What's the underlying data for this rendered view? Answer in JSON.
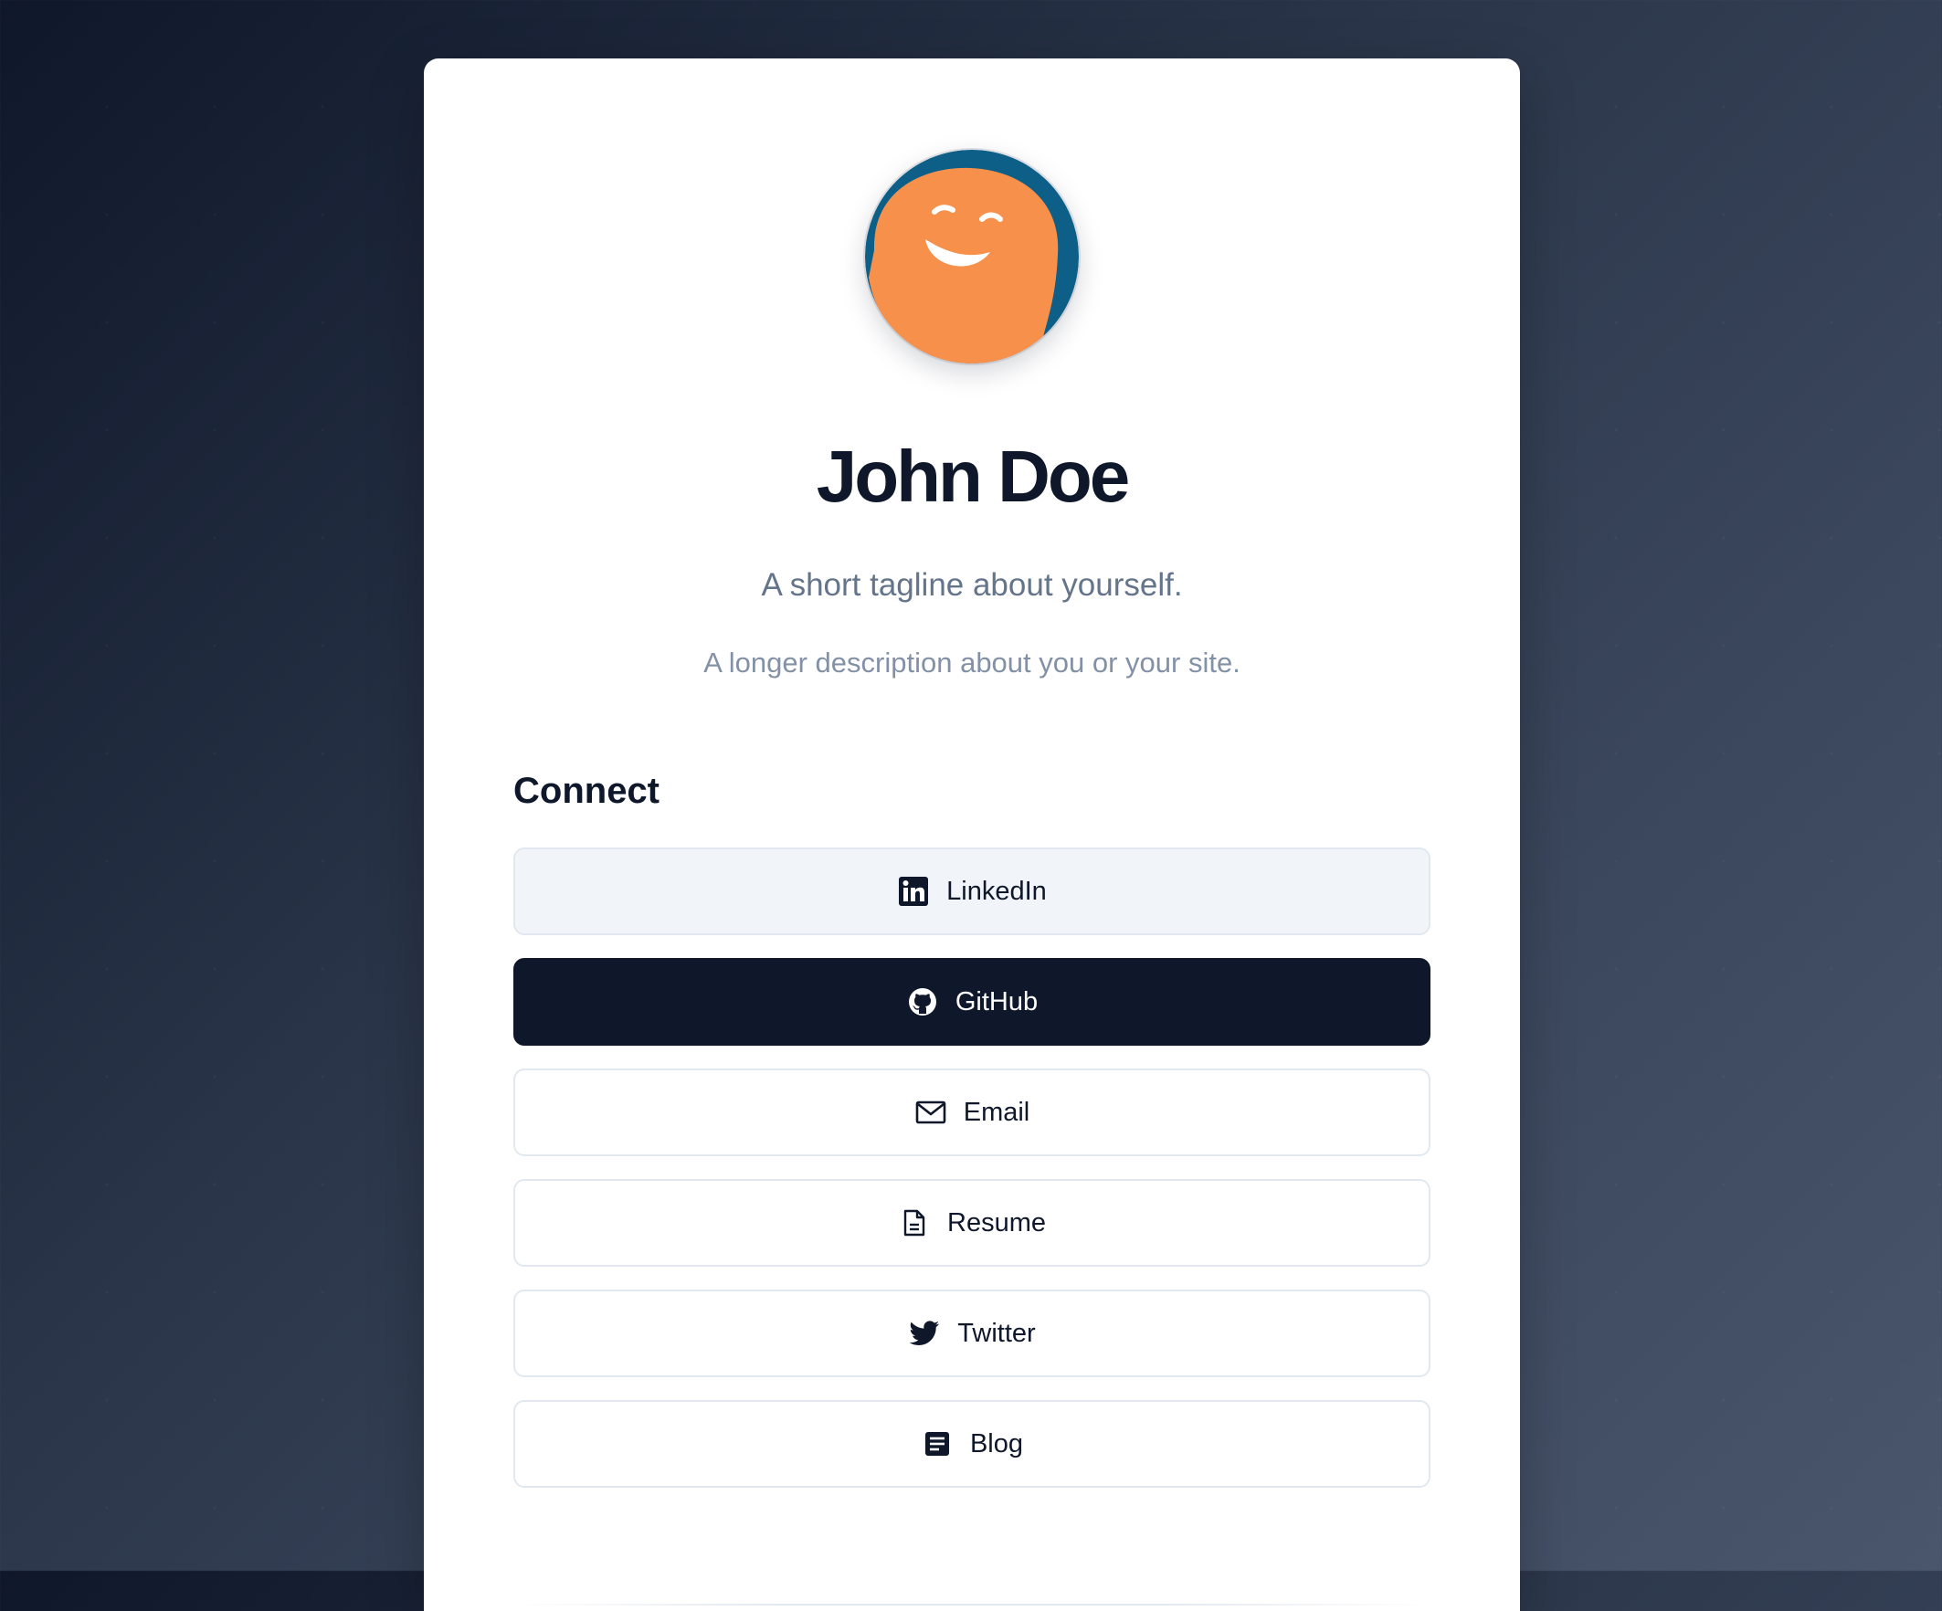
{
  "profile": {
    "name": "John Doe",
    "tagline": "A short tagline about yourself.",
    "description": "A longer description about you or your site.",
    "avatar_icon": "smiling-face-avatar"
  },
  "connect": {
    "title": "Connect",
    "links": [
      {
        "label": "LinkedIn",
        "icon": "linkedin-icon",
        "style": "light"
      },
      {
        "label": "GitHub",
        "icon": "github-icon",
        "style": "dark"
      },
      {
        "label": "Email",
        "icon": "mail-icon",
        "style": "outline"
      },
      {
        "label": "Resume",
        "icon": "document-icon",
        "style": "outline"
      },
      {
        "label": "Twitter",
        "icon": "twitter-icon",
        "style": "outline"
      },
      {
        "label": "Blog",
        "icon": "article-icon",
        "style": "outline"
      }
    ]
  },
  "colors": {
    "primary_text": "#0f172a",
    "muted_text": "#64748b",
    "avatar_orange": "#f7904b",
    "avatar_blue": "#0e5f88",
    "border": "#e2e8f0"
  }
}
